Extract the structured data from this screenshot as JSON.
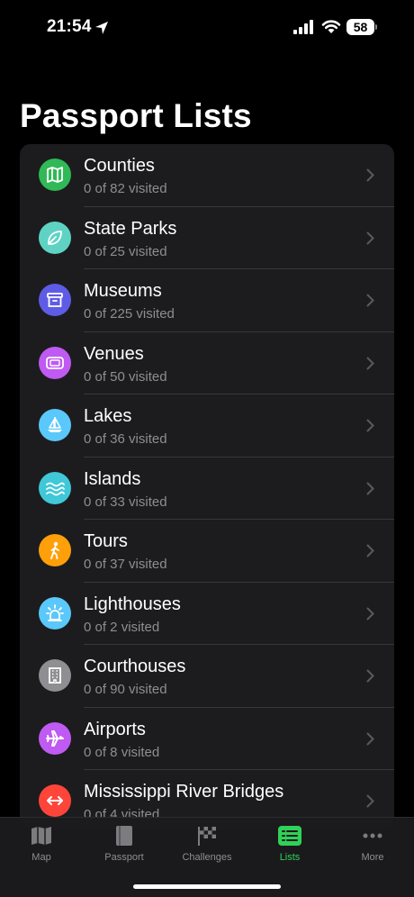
{
  "status_bar": {
    "time": "21:54",
    "battery": "58",
    "icons": [
      "location-arrow-icon",
      "signal-icon",
      "wifi-icon",
      "battery-icon"
    ]
  },
  "page_title": "Passport Lists",
  "lists": [
    {
      "title": "Counties",
      "subtitle": "0 of 82 visited",
      "icon": "map-icon",
      "color": "#30b956"
    },
    {
      "title": "State Parks",
      "subtitle": "0 of 25 visited",
      "icon": "leaf-icon",
      "color": "#5ed3c4"
    },
    {
      "title": "Museums",
      "subtitle": "0 of 225 visited",
      "icon": "archive-box-icon",
      "color": "#5e5ce6"
    },
    {
      "title": "Venues",
      "subtitle": "0 of 50 visited",
      "icon": "ticket-icon",
      "color": "#bf5af2"
    },
    {
      "title": "Lakes",
      "subtitle": "0 of 36 visited",
      "icon": "sailboat-icon",
      "color": "#5ac8fa"
    },
    {
      "title": "Islands",
      "subtitle": "0 of 33 visited",
      "icon": "water-waves-icon",
      "color": "#40c8d8"
    },
    {
      "title": "Tours",
      "subtitle": "0 of 37 visited",
      "icon": "walking-figure-icon",
      "color": "#ff9f0a"
    },
    {
      "title": "Lighthouses",
      "subtitle": "0 of 2 visited",
      "icon": "beacon-light-icon",
      "color": "#5ac8fa"
    },
    {
      "title": "Courthouses",
      "subtitle": "0 of 90 visited",
      "icon": "building-icon",
      "color": "#8e8e93"
    },
    {
      "title": "Airports",
      "subtitle": "0 of 8 visited",
      "icon": "airplane-icon",
      "color": "#bf5af2"
    },
    {
      "title": "Mississippi River Bridges",
      "subtitle": "0 of 4 visited",
      "icon": "double-arrow-icon",
      "color": "#ff453a"
    }
  ],
  "tab_bar": {
    "tabs": [
      {
        "label": "Map",
        "icon": "map-icon",
        "active": false
      },
      {
        "label": "Passport",
        "icon": "book-icon",
        "active": false
      },
      {
        "label": "Challenges",
        "icon": "checkered-flag-icon",
        "active": false
      },
      {
        "label": "Lists",
        "icon": "list-icon",
        "active": true
      },
      {
        "label": "More",
        "icon": "ellipsis-icon",
        "active": false
      }
    ],
    "active_color": "#30d158"
  }
}
